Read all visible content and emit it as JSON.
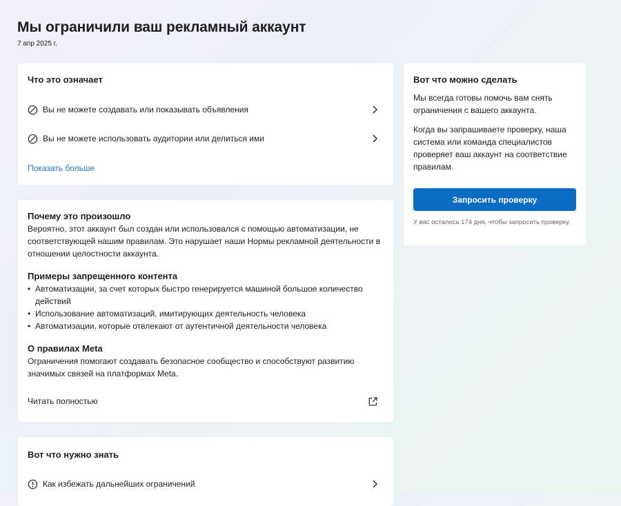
{
  "header": {
    "title": "Мы ограничили ваш рекламный аккаунт",
    "date": "7 апр 2025 г."
  },
  "meaning": {
    "heading": "Что это означает",
    "items": [
      {
        "label": "Вы не можете создавать или показывать объявления",
        "icon": "blocked-icon"
      },
      {
        "label": "Вы не можете использовать аудитории или делиться ими",
        "icon": "blocked-icon"
      }
    ],
    "show_more": "Показать больше"
  },
  "why": {
    "heading": "Почему это произошло",
    "text": "Вероятно, этот аккаунт был создан или использовался с помощью автоматизации, не соответствующей нашим правилам. Это нарушает наши Нормы рекламной деятельности в отношении целостности аккаунта.",
    "examples_heading": "Примеры запрещенного контента",
    "examples": [
      "Автоматизации, за счет которых быстро генерируется машиной большое количество действий",
      "Использование автоматизаций, имитирующих деятельность человека",
      "Автоматизации, которые отвлекают от аутентичной деятельности человека"
    ],
    "rules_heading": "О правилах Meta",
    "rules_text": "Ограничения помогают создавать безопасное сообщество и способствуют развитию значимых связей на платформах Meta.",
    "read_more": "Читать полностью"
  },
  "know": {
    "heading": "Вот что нужно знать",
    "items": [
      {
        "label": "Как избежать дальнейших ограничений",
        "icon": "info-icon"
      }
    ]
  },
  "actions": {
    "heading": "Вот что можно сделать",
    "text1": "Мы всегда готовы помочь вам снять ограничения с вашего аккаунта.",
    "text2": "Когда вы запрашиваете проверку, наша система или команда специалистов проверяет ваш аккаунт на соответствие правилам.",
    "button": "Запросить проверку",
    "note": "У вас осталось 174 дня, чтобы запросить проверку."
  },
  "colors": {
    "accent": "#0b6cc4",
    "link": "#1877c9"
  }
}
